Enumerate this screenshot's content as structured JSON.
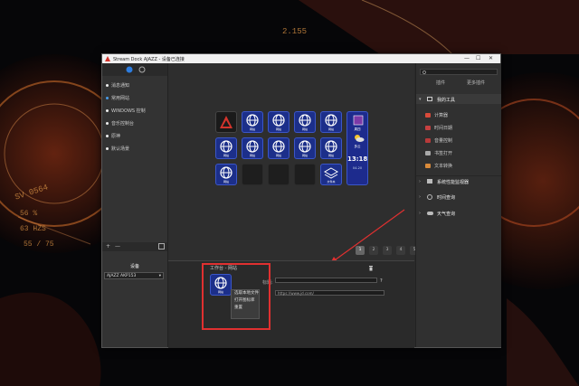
{
  "hud": {
    "a": "2.155",
    "b": "SV 0564",
    "c": "56 %",
    "d": "63 HZS",
    "e": "55 / 75"
  },
  "window": {
    "title": "Stream Dock AJAZZ - 设备已连接",
    "min": "—",
    "max": "☐",
    "close": "✕"
  },
  "sidebar": {
    "items": [
      {
        "label": "消息通知",
        "active": false
      },
      {
        "label": "常用网站",
        "active": true
      },
      {
        "label": "WINDOWS 控制",
        "active": false
      },
      {
        "label": "音乐控制台",
        "active": false
      },
      {
        "label": "原神",
        "active": false
      },
      {
        "label": "默认场景",
        "active": false
      }
    ],
    "add": "+",
    "remove": "—",
    "device_label": "设备",
    "device_value": "AJAZZ AKP153"
  },
  "keys": {
    "labels": [
      "网站",
      "网站",
      "网站",
      "网站",
      "网站",
      "网站",
      "网站",
      "网站",
      "网站"
    ],
    "folder_label": "文件夹",
    "clock_day": "周四",
    "clock_time": "13:18",
    "clock_weather": "多云",
    "clock_date": "04-20"
  },
  "pages": [
    "1",
    "2",
    "3",
    "4",
    "5"
  ],
  "properties": {
    "title": "工作台 - 网站",
    "field_title_label": "标题:",
    "field_title_value": "",
    "help": "?",
    "url_value": "https://www.jd.com/",
    "key_label": "网站",
    "context_menu": [
      "选取本地文件",
      "打开图标库",
      "重置"
    ]
  },
  "right": {
    "search_placeholder": "",
    "tab1": "插件",
    "tab2": "更多插件",
    "group1": "我的工具",
    "group1_items": [
      "计算器",
      "时间日期",
      "音量控制",
      "书签打开",
      "文本转换"
    ],
    "group2": "系统性能监视器",
    "group3": "时间查询",
    "group4": "天气查询"
  }
}
